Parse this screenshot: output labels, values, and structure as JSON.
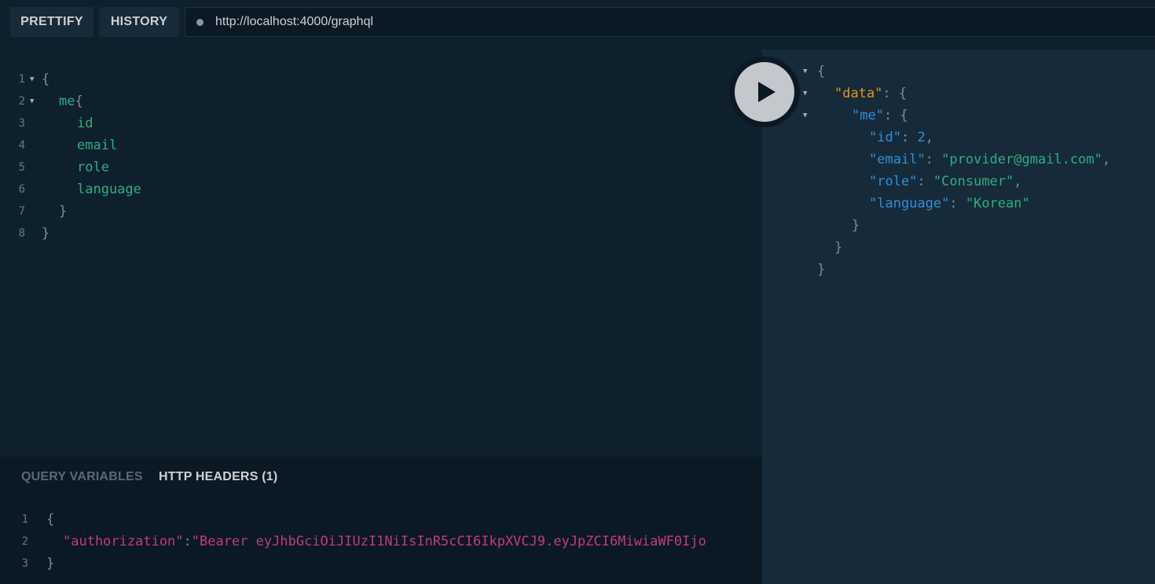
{
  "toolbar": {
    "prettify_label": "PRETTIFY",
    "history_label": "HISTORY",
    "url": "http://localhost:4000/graphql"
  },
  "editor": {
    "line_numbers": [
      "1",
      "2",
      "3",
      "4",
      "5",
      "6",
      "7",
      "8"
    ],
    "lines": {
      "l1": "{",
      "l2_field": "me",
      "l2_brace": "{",
      "l3": "id",
      "l4": "email",
      "l5": "role",
      "l6": "language",
      "l7": "}",
      "l8": "}"
    }
  },
  "result": {
    "open_brace": "{",
    "data_key": "\"data\"",
    "me_key": "\"me\"",
    "id_key": "\"id\"",
    "id_value": "2",
    "email_key": "\"email\"",
    "email_value": "\"provider@gmail.com\"",
    "role_key": "\"role\"",
    "role_value": "\"Consumer\"",
    "language_key": "\"language\"",
    "language_value": "\"Korean\"",
    "close_brace": "}",
    "colon": ": ",
    "comma": ",",
    "brace_open_suffix": ": {"
  },
  "variables_panel": {
    "query_variables_tab": "QUERY VARIABLES",
    "http_headers_tab": "HTTP HEADERS (1)",
    "line_numbers": [
      "1",
      "2",
      "3"
    ],
    "open_brace": "{",
    "header_key": "\"authorization\"",
    "header_colon": ":",
    "header_value": "\"Bearer eyJhbGciOiJIUzI1NiIsInR5cCI6IkpXVCJ9.eyJpZCI6MiwiaWF0Ijo",
    "close_brace": "}"
  },
  "icons": {
    "run": "play-icon",
    "status": "status-dot-icon",
    "fold": "fold-arrow-icon"
  },
  "colors": {
    "background": "#0f202d",
    "result_background": "#172a3a",
    "field": "#2fae7f",
    "json_key": "#2d8fd6",
    "data_key": "#e2951a",
    "header_key": "#c33b7c"
  }
}
